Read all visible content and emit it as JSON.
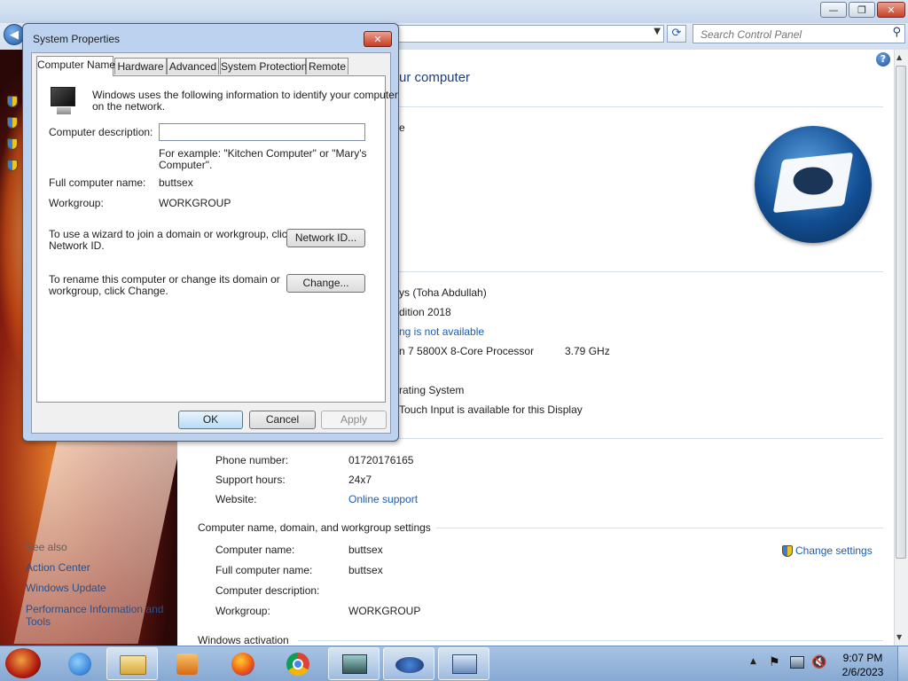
{
  "control_panel": {
    "search_placeholder": "Search Control Panel",
    "heading_fragment": "ur computer",
    "windows_edition_fragment": "e",
    "system": {
      "registered_fragment": "ys (Toha Abdullah)",
      "edition_fragment": "dition 2018",
      "rating_link_fragment": "ng is not available",
      "processor_fragment": "n 7 5800X 8-Core Processor",
      "processor_speed": "3.79 GHz",
      "system_type_fragment": "rating System",
      "pen_touch_fragment": "Touch Input is available for this Display"
    },
    "support": {
      "phone_label": "Phone number:",
      "phone_value": "01720176165",
      "hours_label": "Support hours:",
      "hours_value": "24x7",
      "website_label": "Website:",
      "website_value": "Online support"
    },
    "computer_name_section": {
      "title": "Computer name, domain, and workgroup settings",
      "computer_name_label": "Computer name:",
      "computer_name_value": "buttsex",
      "full_name_label": "Full computer name:",
      "full_name_value": "buttsex",
      "description_label": "Computer description:",
      "workgroup_label": "Workgroup:",
      "workgroup_value": "WORKGROUP",
      "change_settings": "Change settings"
    },
    "windows_activation": "Windows activation",
    "left_pane": {
      "see_also": "See also",
      "action_center": "Action Center",
      "windows_update": "Windows Update",
      "performance_1": "Performance Information and",
      "performance_2": "Tools"
    }
  },
  "dialog": {
    "title": "System Properties",
    "tabs": [
      "Computer Name",
      "Hardware",
      "Advanced",
      "System Protection",
      "Remote"
    ],
    "intro_1": "Windows uses the following information to identify your computer",
    "intro_2": "on the network.",
    "description_label": "Computer description:",
    "description_value": "",
    "example_1": "For example: \"Kitchen Computer\" or \"Mary's",
    "example_2": "Computer\".",
    "full_name_label": "Full computer name:",
    "full_name_value": "buttsex",
    "workgroup_label": "Workgroup:",
    "workgroup_value": "WORKGROUP",
    "network_id_text_1": "To use a wizard to join a domain or workgroup, click",
    "network_id_text_2": "Network ID.",
    "network_id_button": "Network ID...",
    "rename_text_1": "To rename this computer or change its domain or",
    "rename_text_2": "workgroup, click Change.",
    "change_button": "Change...",
    "ok_button": "OK",
    "cancel_button": "Cancel",
    "apply_button": "Apply"
  },
  "taskbar": {
    "time": "9:07 PM",
    "date": "2/6/2023"
  },
  "colors": {
    "link": "#1d5cb0",
    "dialog_frame": "#bcd2ee",
    "taskbar": "#a8c4e4"
  }
}
